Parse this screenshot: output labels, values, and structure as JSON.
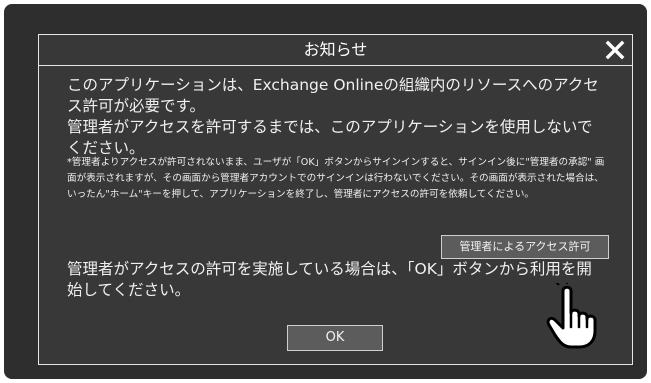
{
  "dialog": {
    "title": "お知らせ",
    "message_line1": "このアプリケーションは、Exchange Onlineの組織内のリソースへのアクセス許可が必要です。",
    "message_line2": "管理者がアクセスを許可するまでは、このアプリケーションを使用しないでください。",
    "note": "*管理者よりアクセスが許可されないまま、ユーザが「OK」ボタンからサインインすると、サインイン後に\"管理者の承認\" 画面が表示されますが、その画面から管理者アカウントでのサインインは行わないでください。その画面が表示された場合は、いったん\"ホーム\"キーを押して、アプリケーションを終了し、管理者にアクセスの許可を依頼してください。",
    "admin_button_label": "管理者によるアクセス許可",
    "message_line3": "管理者がアクセスの許可を実施している場合は、「OK」ボタンから利用を開始してください。",
    "ok_button_label": "OK"
  },
  "icons": {
    "close": "close-icon",
    "pointer": "pointer-hand-icon"
  },
  "colors": {
    "screen_background": "#2e2e2e",
    "dialog_background": "#383838",
    "button_background": "#5c5c5c",
    "border": "#e6e6e6",
    "text": "#f0f0f0"
  }
}
